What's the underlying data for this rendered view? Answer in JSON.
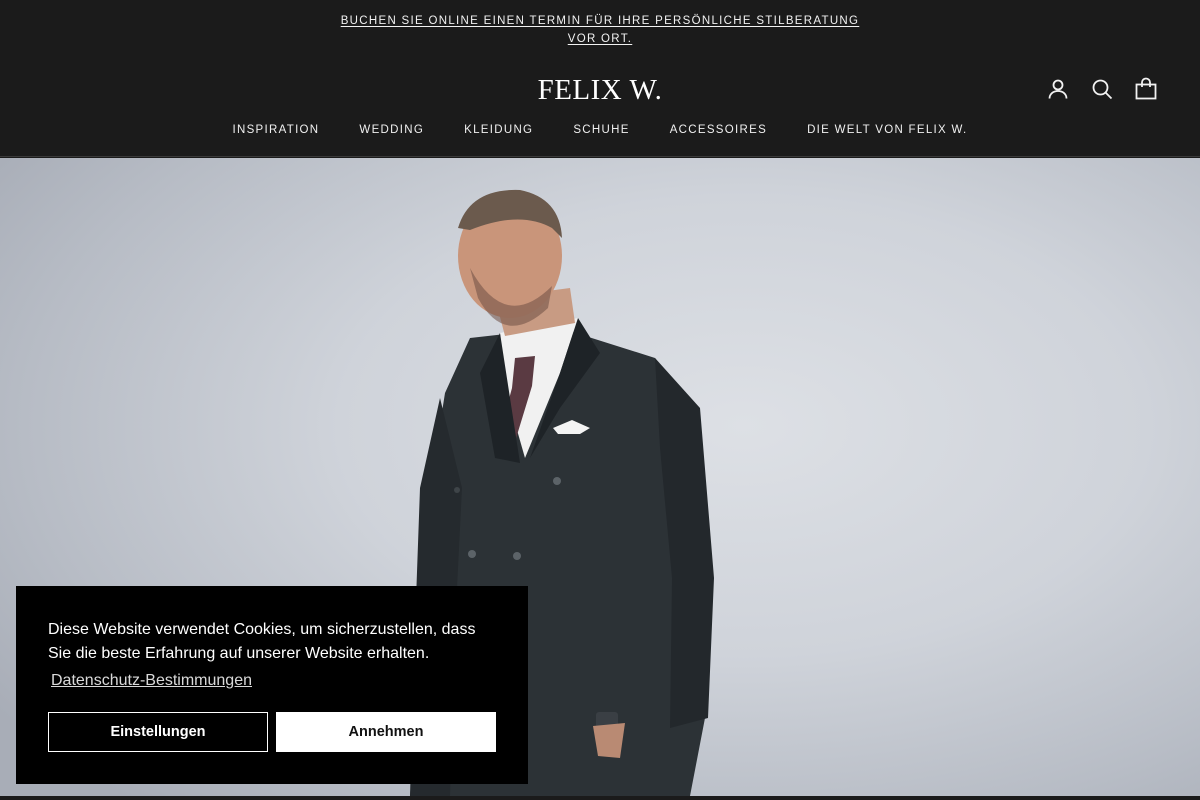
{
  "announcement": {
    "text": "BUCHEN SIE ONLINE EINEN TERMIN FÜR IHRE PERSÖNLICHE STILBERATUNG VOR ORT."
  },
  "header": {
    "logo": "FELIX W.",
    "icons": [
      "account-icon",
      "search-icon",
      "bag-icon"
    ]
  },
  "nav": {
    "items": [
      {
        "label": "INSPIRATION"
      },
      {
        "label": "WEDDING"
      },
      {
        "label": "KLEIDUNG"
      },
      {
        "label": "SCHUHE"
      },
      {
        "label": "ACCESSOIRES"
      },
      {
        "label": "DIE WELT VON FELIX W."
      }
    ]
  },
  "cookie_banner": {
    "message": "Diese Website verwendet Cookies, um sicherzustellen, dass Sie die beste Erfahrung auf unserer Website erhalten.",
    "privacy_link": "Datenschutz-Bestimmungen",
    "settings_button": "Einstellungen",
    "accept_button": "Annehmen"
  },
  "colors": {
    "header_bg": "#1b1b1b",
    "banner_bg": "#000000",
    "text_light": "#ffffff"
  }
}
